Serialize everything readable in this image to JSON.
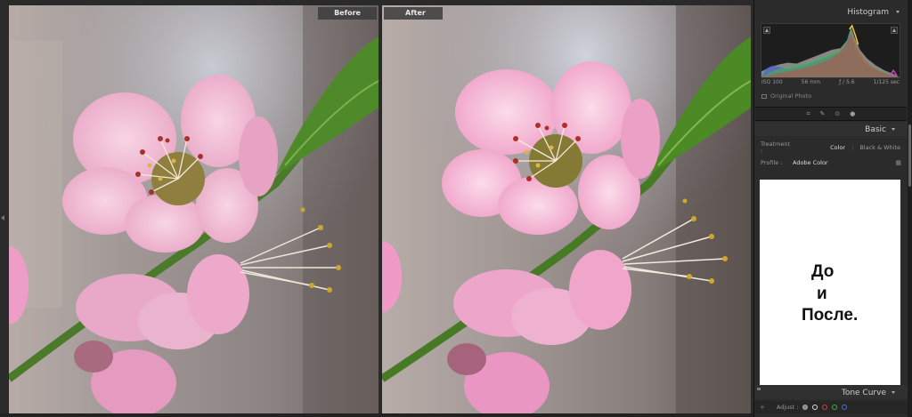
{
  "viewer": {
    "before_label": "Before",
    "after_label": "After"
  },
  "panel": {
    "histogram_title": "Histogram",
    "exif": {
      "iso": "ISO 100",
      "focal": "56 mm",
      "aperture": "ƒ / 5.6",
      "shutter": "1/125 sec"
    },
    "original_photo": "Original Photo",
    "basic_title": "Basic",
    "treatment_label": "Treatment :",
    "treatment_color": "Color",
    "treatment_bw": "Black & White",
    "profile_label": "Profile :",
    "profile_value": "Adobe Color",
    "overlay_lines": [
      "До",
      "и",
      "После."
    ],
    "tone_curve_title": "Tone Curve",
    "adjust_label": "Adjust :"
  },
  "colors": {
    "panel_bg": "#2b2b2b",
    "petal": "#f2b6d2",
    "leaf": "#4f8a2a"
  }
}
